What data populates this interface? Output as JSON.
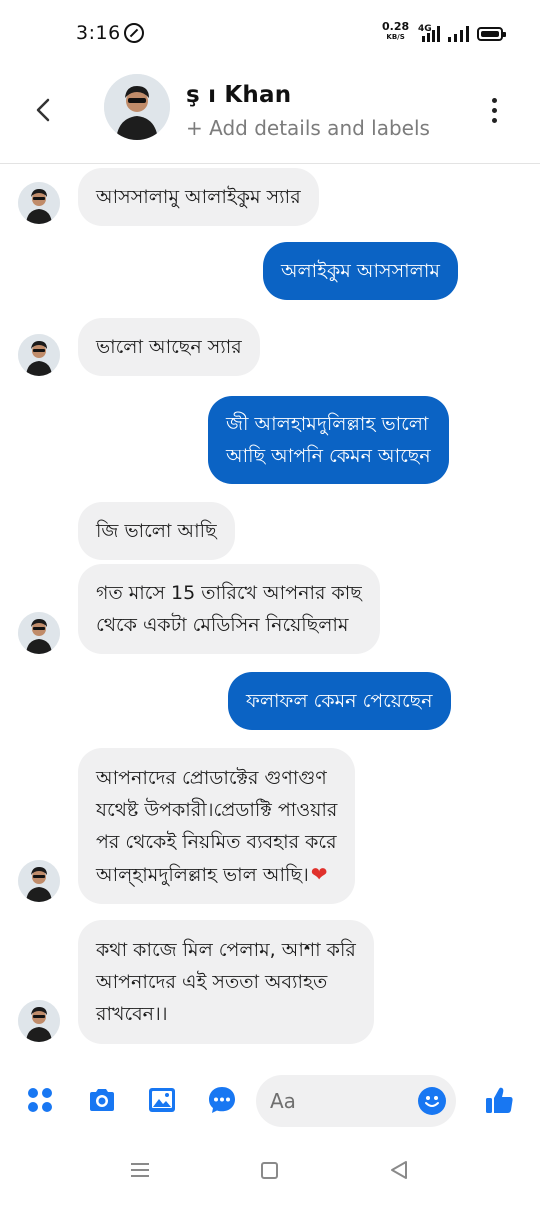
{
  "status_bar": {
    "time": "3:16",
    "net_speed": "0.28",
    "net_unit": "KB/S",
    "network_type": "4G"
  },
  "header": {
    "contact_name": "ş       ı Khan",
    "subtitle": "+ Add details and labels"
  },
  "messages": [
    {
      "side": "in",
      "text": "আসসালামু আলাইকুম স্যার"
    },
    {
      "side": "out",
      "text": "অলাইকুম আসসালাম"
    },
    {
      "side": "in",
      "text": "ভালো আছেন স্যার"
    },
    {
      "side": "out",
      "text": "জী আলহামদুলিল্লাহ ভালো\nআছি আপনি কেমন আছেন"
    },
    {
      "side": "in",
      "text": "জি ভালো আছি"
    },
    {
      "side": "in",
      "text": "গত মাসে 15 তারিখে আপনার কাছ\nথেকে একটা মেডিসিন নিয়েছিলাম"
    },
    {
      "side": "out",
      "text": "ফলাফল কেমন পেয়েছেন"
    },
    {
      "side": "in",
      "text": "আপনাদের প্রোডাক্টের গুণাগুণ\nযথেষ্ট উপকারী।প্রেডাক্টি পাওয়ার\nপর থেকেই নিয়মিত ব্যবহার করে\nআল্হামদুলিল্লাহ ভাল আছি।",
      "emoji": "❤"
    },
    {
      "side": "in",
      "text": "কথা  কাজে মিল পেলাম, আশা করি\nআপনাদের এই সততা অব্যাহত\nরাখবেন।।"
    }
  ],
  "composer": {
    "placeholder": "Aa"
  },
  "colors": {
    "outgoing_bubble": "#0b63c4",
    "incoming_bubble": "#f0f0f1",
    "messenger_blue": "#1877f2"
  },
  "icons": [
    "back-arrow-icon",
    "more-vertical-icon",
    "apps-grid-icon",
    "camera-icon",
    "gallery-icon",
    "chat-options-icon",
    "emoji-icon",
    "thumbs-up-icon",
    "nav-menu-icon",
    "nav-home-icon",
    "nav-back-icon"
  ]
}
